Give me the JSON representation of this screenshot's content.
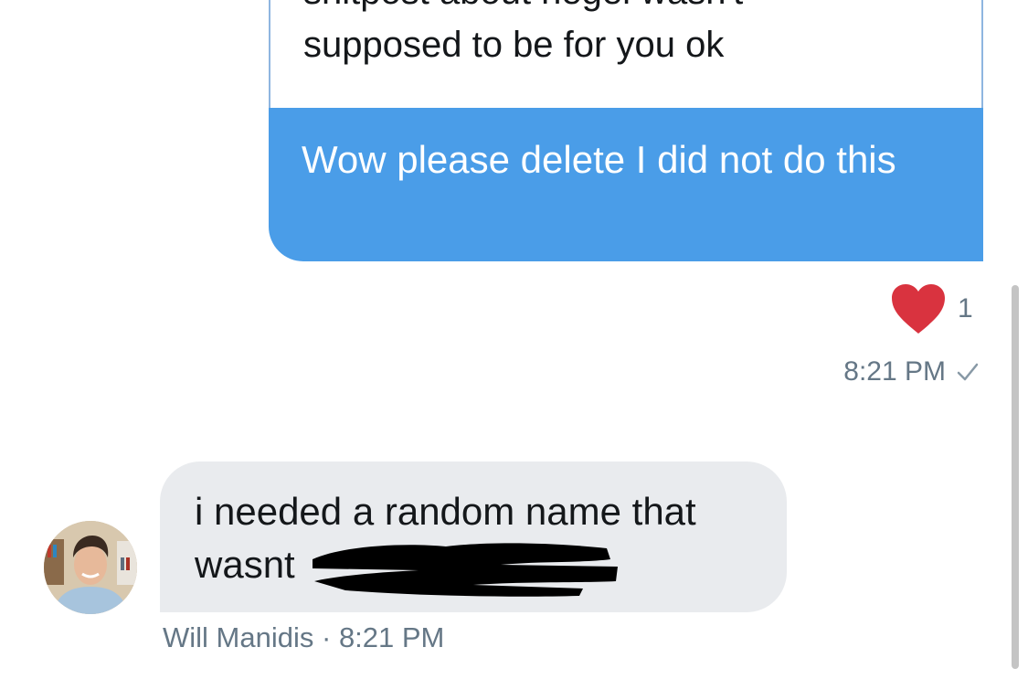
{
  "quoted": {
    "line1": "shitpost about hegel wasn't",
    "line2": "supposed to be for you ok"
  },
  "sent_message": {
    "text": "Wow please delete I did not do this",
    "reaction_count": "1",
    "timestamp": "8:21 PM"
  },
  "received_message": {
    "text_line1": "i needed a random name that",
    "text_line2": "wasnt",
    "sender": "Will Manidis",
    "separator": "·",
    "timestamp": "8:21 PM"
  },
  "colors": {
    "sent_bubble": "#4a9de8",
    "received_bubble": "#e9ebee",
    "heart": "#e0245e",
    "meta_text": "#657786"
  }
}
